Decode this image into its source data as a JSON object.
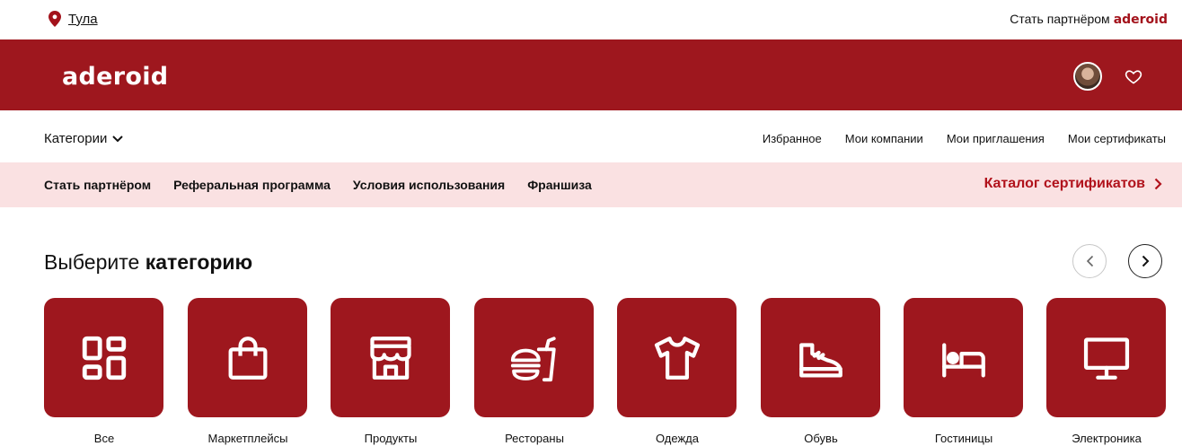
{
  "top": {
    "city": "Тула",
    "partner_text": "Стать партнёром",
    "partner_brand": "aderoid"
  },
  "header": {
    "logo": "aderoid",
    "icons": [
      "avatar",
      "heart-icon"
    ]
  },
  "nav": {
    "categories_label": "Категории",
    "links": [
      "Избранное",
      "Мои компании",
      "Мои приглашения",
      "Мои сертификаты"
    ]
  },
  "subnav": {
    "links": [
      "Стать партнёром",
      "Реферальная программа",
      "Условия использования",
      "Франшиза"
    ],
    "catalog": "Каталог сертификатов"
  },
  "section": {
    "title_regular": "Выберите",
    "title_bold": "категорию"
  },
  "categories": [
    {
      "label": "Все",
      "icon": "grid-icon"
    },
    {
      "label": "Маркетплейсы",
      "icon": "shopping-bag-icon"
    },
    {
      "label": "Продукты",
      "icon": "store-icon"
    },
    {
      "label": "Рестораны",
      "icon": "fast-food-icon"
    },
    {
      "label": "Одежда",
      "icon": "tshirt-icon"
    },
    {
      "label": "Обувь",
      "icon": "sneaker-icon"
    },
    {
      "label": "Гостиницы",
      "icon": "bed-icon"
    },
    {
      "label": "Электроника",
      "icon": "monitor-icon"
    }
  ],
  "colors": {
    "brand": "#9e171e",
    "accent_text": "#b1121c",
    "subnav_bg": "#fae1e2"
  }
}
